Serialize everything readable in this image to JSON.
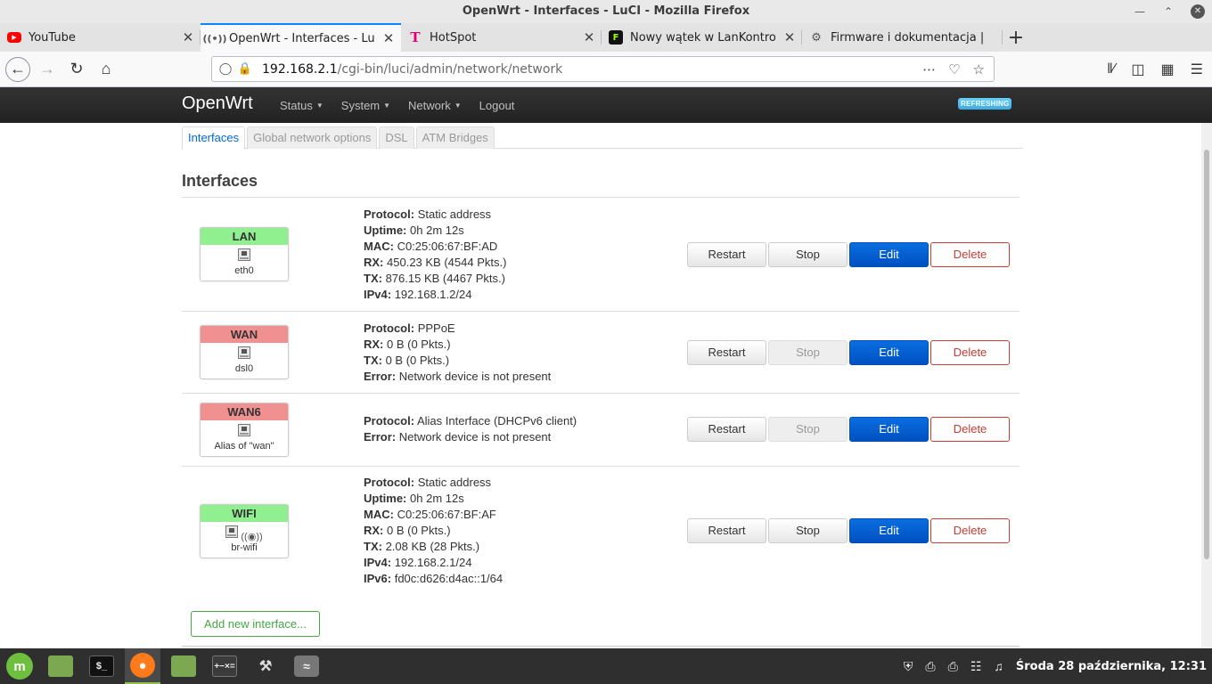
{
  "window": {
    "title": "OpenWrt - Interfaces - LuCI - Mozilla Firefox"
  },
  "tabs": [
    {
      "label": "YouTube",
      "icon": "youtube-icon"
    },
    {
      "label": "OpenWrt - Interfaces - LuCI",
      "icon": "openwrt-icon",
      "active": true
    },
    {
      "label": "HotSpot",
      "icon": "telekom-icon"
    },
    {
      "label": "Nowy wątek w LanKontrole",
      "icon": "forum-icon"
    },
    {
      "label": "Firmware i dokumentacja | ",
      "icon": "firmware-icon"
    }
  ],
  "url": {
    "host": "192.168.2.1",
    "path": "/cgi-bin/luci/admin/network/network"
  },
  "luci": {
    "brand": "OpenWrt",
    "menu": [
      "Status",
      "System",
      "Network",
      "Logout"
    ],
    "badge": "REFRESHING",
    "subtabs": [
      "Interfaces",
      "Global network options",
      "DSL",
      "ATM Bridges"
    ],
    "section_title": "Interfaces",
    "add_button": "Add new interface..."
  },
  "buttons": {
    "restart": "Restart",
    "stop": "Stop",
    "edit": "Edit",
    "delete": "Delete"
  },
  "labels": {
    "protocol": "Protocol:",
    "uptime": "Uptime:",
    "mac": "MAC:",
    "rx": "RX:",
    "tx": "TX:",
    "ipv4": "IPv4:",
    "ipv6": "IPv6:",
    "error": "Error:"
  },
  "interfaces": [
    {
      "name": "LAN",
      "status": "up",
      "device": "eth0",
      "protocol": "Static address",
      "uptime": "0h 2m 12s",
      "mac": "C0:25:06:67:BF:AD",
      "rx": "450.23 KB (4544 Pkts.)",
      "tx": "876.15 KB (4467 Pkts.)",
      "ipv4": "192.168.1.2/24",
      "stop_enabled": true
    },
    {
      "name": "WAN",
      "status": "down",
      "device": "dsl0",
      "protocol": "PPPoE",
      "rx": "0 B (0 Pkts.)",
      "tx": "0 B (0 Pkts.)",
      "error": "Network device is not present",
      "stop_enabled": false
    },
    {
      "name": "WAN6",
      "status": "down",
      "device": "Alias of \"wan\"",
      "protocol": "Alias Interface (DHCPv6 client)",
      "error": "Network device is not present",
      "stop_enabled": false
    },
    {
      "name": "WIFI",
      "status": "up",
      "device": "br-wifi",
      "protocol": "Static address",
      "uptime": "0h 2m 12s",
      "mac": "C0:25:06:67:BF:AF",
      "rx": "0 B (0 Pkts.)",
      "tx": "2.08 KB (28 Pkts.)",
      "ipv4": "192.168.2.1/24",
      "ipv6": "fd0c:d626:d4ac::1/64",
      "stop_enabled": true
    }
  ],
  "taskbar": {
    "clock": "Środa 28 października, 12:31",
    "apps": [
      "mint-menu-icon",
      "files-icon",
      "terminal-icon",
      "firefox-icon",
      "folder-icon",
      "calculator-icon",
      "dbeaver-icon",
      "wifi-settings-icon"
    ]
  }
}
